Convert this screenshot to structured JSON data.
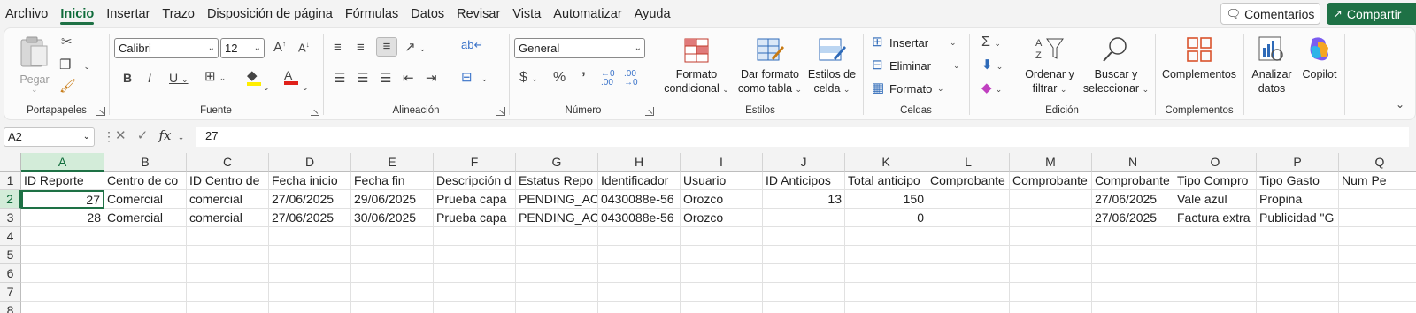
{
  "menu": {
    "tabs": [
      "Archivo",
      "Inicio",
      "Insertar",
      "Trazo",
      "Disposición de página",
      "Fórmulas",
      "Datos",
      "Revisar",
      "Vista",
      "Automatizar",
      "Ayuda"
    ],
    "active_tab": "Inicio",
    "comments_label": "Comentarios",
    "share_label": "Compartir"
  },
  "ribbon": {
    "clipboard": {
      "paste_label": "Pegar",
      "group_label": "Portapapeles"
    },
    "font": {
      "font_name": "Calibri",
      "font_size": "12",
      "group_label": "Fuente"
    },
    "alignment": {
      "group_label": "Alineación"
    },
    "number": {
      "format": "General",
      "group_label": "Número"
    },
    "styles": {
      "conditional_format_line1": "Formato",
      "conditional_format_line2": "condicional",
      "format_table_line1": "Dar formato",
      "format_table_line2": "como tabla",
      "cell_styles_line1": "Estilos de",
      "cell_styles_line2": "celda",
      "group_label": "Estilos"
    },
    "cells": {
      "insert": "Insertar",
      "delete": "Eliminar",
      "format": "Formato",
      "group_label": "Celdas"
    },
    "editing": {
      "sort_line1": "Ordenar y",
      "sort_line2": "filtrar",
      "find_line1": "Buscar y",
      "find_line2": "seleccionar",
      "group_label": "Edición"
    },
    "addins": {
      "label": "Complementos",
      "group_label": "Complementos"
    },
    "analyze": {
      "line1": "Analizar",
      "line2": "datos"
    },
    "copilot": {
      "label": "Copilot"
    }
  },
  "formula_bar": {
    "name_box": "A2",
    "formula": "27"
  },
  "sheet": {
    "columns": [
      "A",
      "B",
      "C",
      "D",
      "E",
      "F",
      "G",
      "H",
      "I",
      "J",
      "K",
      "L",
      "M",
      "N",
      "O",
      "P",
      "Q"
    ],
    "rows": [
      "1",
      "2",
      "3",
      "4",
      "5",
      "6",
      "7",
      "8"
    ],
    "data": [
      [
        "ID Reporte",
        "Centro de co",
        "ID Centro de",
        "Fecha inicio",
        "Fecha fin",
        "Descripción d",
        "Estatus Repo",
        "Identificador",
        "Usuario",
        "ID Anticipos",
        "Total anticipo",
        "Comprobante",
        "Comprobante",
        "Comprobante",
        "Tipo Compro",
        "Tipo Gasto",
        "Num Pe"
      ],
      [
        "27",
        "Comercial",
        "comercial",
        "27/06/2025",
        "29/06/2025",
        "Prueba capa",
        "PENDING_AC",
        "0430088e-56",
        "Orozco",
        "13",
        "150",
        "",
        "",
        "27/06/2025",
        "Vale azul",
        "Propina",
        ""
      ],
      [
        "28",
        "Comercial",
        "comercial",
        "27/06/2025",
        "30/06/2025",
        "Prueba capa",
        "PENDING_AC",
        "0430088e-56",
        "Orozco",
        "",
        "0",
        "",
        "",
        "27/06/2025",
        "Factura extra",
        "Publicidad \"G",
        ""
      ]
    ]
  }
}
